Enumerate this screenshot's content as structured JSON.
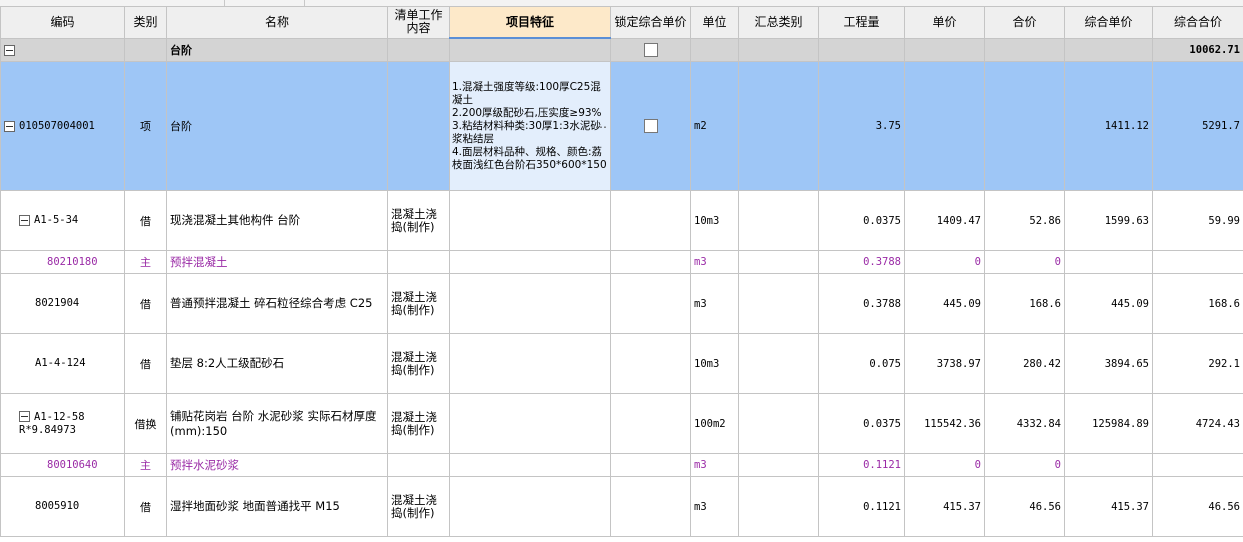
{
  "columns": [
    "编码",
    "类别",
    "名称",
    "清单工作内容",
    "项目特征",
    "锁定综合单价",
    "单位",
    "汇总类别",
    "工程量",
    "单价",
    "合价",
    "综合单价",
    "综合合价"
  ],
  "group": {
    "name": "台阶",
    "total": "10062.71"
  },
  "item": {
    "code": "010507004001",
    "type": "项",
    "name": "台阶",
    "feature": "1.混凝土强度等级:100厚C25混凝土\n2.200厚级配砂石,压实度≥93%\n3.粘结材料种类:30厚1:3水泥砂浆粘结层\n4.面层材料品种、规格、颜色:荔枝面浅红色台阶石350*600*150",
    "ellipsis": "…",
    "unit": "m2",
    "qty": "3.75",
    "comp_price": "1411.12",
    "comp_total": "5291.7"
  },
  "rows": [
    {
      "code": "A1-5-34",
      "type": "借",
      "name": "现浇混凝土其他构件 台阶",
      "work": "混凝土浇捣(制作)",
      "unit": "10m3",
      "qty": "0.0375",
      "price": "1409.47",
      "total": "52.86",
      "comp_price": "1599.63",
      "comp_total": "59.99"
    },
    {
      "code": "80210180",
      "type": "主",
      "name": "预拌混凝土",
      "work": "",
      "unit": "m3",
      "qty": "0.3788",
      "price": "0",
      "total": "0",
      "comp_price": "",
      "comp_total": ""
    },
    {
      "code": "8021904",
      "type": "借",
      "name": "普通预拌混凝土 碎石粒径综合考虑 C25",
      "work": "混凝土浇捣(制作)",
      "unit": "m3",
      "qty": "0.3788",
      "price": "445.09",
      "total": "168.6",
      "comp_price": "445.09",
      "comp_total": "168.6"
    },
    {
      "code": "A1-4-124",
      "type": "借",
      "name": "垫层 8:2人工级配砂石",
      "work": "混凝土浇捣(制作)",
      "unit": "10m3",
      "qty": "0.075",
      "price": "3738.97",
      "total": "280.42",
      "comp_price": "3894.65",
      "comp_total": "292.1"
    },
    {
      "code": "A1-12-58 R*9.84973",
      "type": "借换",
      "name": "铺贴花岗岩 台阶 水泥砂浆 实际石材厚度(mm):150",
      "work": "混凝土浇捣(制作)",
      "unit": "100m2",
      "qty": "0.0375",
      "price": "115542.36",
      "total": "4332.84",
      "comp_price": "125984.89",
      "comp_total": "4724.43"
    },
    {
      "code": "80010640",
      "type": "主",
      "name": "预拌水泥砂浆",
      "work": "",
      "unit": "m3",
      "qty": "0.1121",
      "price": "0",
      "total": "0",
      "comp_price": "",
      "comp_total": ""
    },
    {
      "code": "8005910",
      "type": "借",
      "name": "湿拌地面砂浆 地面普通找平 M15",
      "work": "混凝土浇捣(制作)",
      "unit": "m3",
      "qty": "0.1121",
      "price": "415.37",
      "total": "46.56",
      "comp_price": "415.37",
      "comp_total": "46.56"
    }
  ]
}
